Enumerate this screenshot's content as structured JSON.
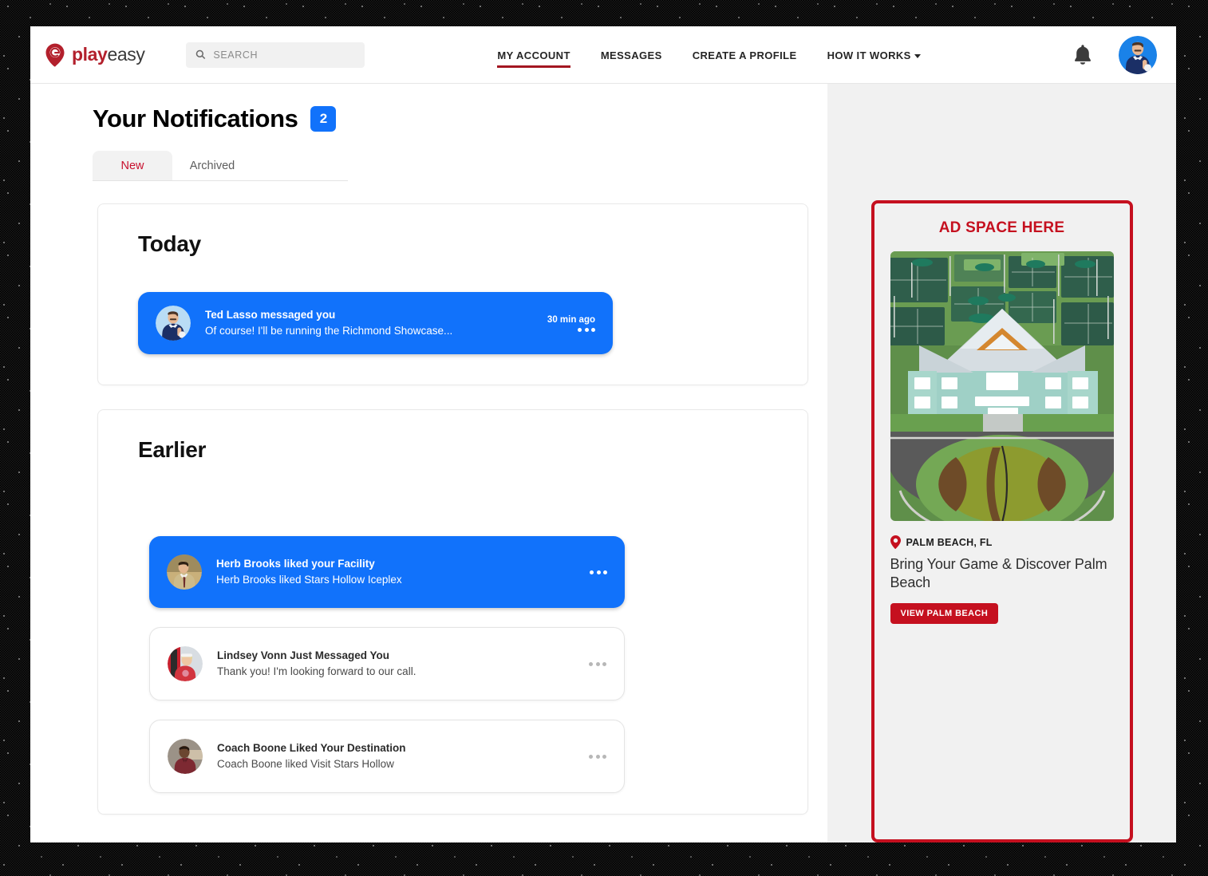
{
  "brand": {
    "name_bold": "play",
    "name_light": "easy",
    "color": "#b3202c"
  },
  "search": {
    "placeholder": "SEARCH",
    "value": ""
  },
  "nav": {
    "items": [
      {
        "label": "MY ACCOUNT",
        "active": true
      },
      {
        "label": "MESSAGES",
        "active": false
      },
      {
        "label": "CREATE A PROFILE",
        "active": false
      },
      {
        "label": "HOW IT WORKS",
        "active": false,
        "has_caret": true
      }
    ]
  },
  "page": {
    "title": "Your Notifications",
    "badge_count": "2",
    "badge_color": "#1172fb"
  },
  "tabs": [
    {
      "label": "New",
      "active": true
    },
    {
      "label": "Archived",
      "active": false
    }
  ],
  "sections": [
    {
      "heading": "Today",
      "items": [
        {
          "title": "Ted Lasso messaged you",
          "subtitle": "Of course! I'll be running the Richmond Showcase...",
          "time": "30 min ago",
          "unread": true
        }
      ]
    },
    {
      "heading": "Earlier",
      "items": [
        {
          "title": "Herb Brooks liked your Facility",
          "subtitle": "Herb Brooks liked Stars Hollow Iceplex",
          "time": "",
          "unread": true
        },
        {
          "title": "Lindsey Vonn Just Messaged You",
          "subtitle": "Thank you! I'm looking forward to our call.",
          "time": "",
          "unread": false
        },
        {
          "title": "Coach Boone Liked Your Destination",
          "subtitle": "Coach Boone liked Visit Stars Hollow",
          "time": "",
          "unread": false
        }
      ]
    }
  ],
  "ad": {
    "heading": "AD SPACE HERE",
    "location": "PALM BEACH, FL",
    "title": "Bring Your Game & Discover Palm Beach",
    "button": "VIEW PALM BEACH",
    "accent_color": "#c5101f",
    "image_alt": "aerial view of tennis club with tennis-ball hedge roundabout"
  }
}
